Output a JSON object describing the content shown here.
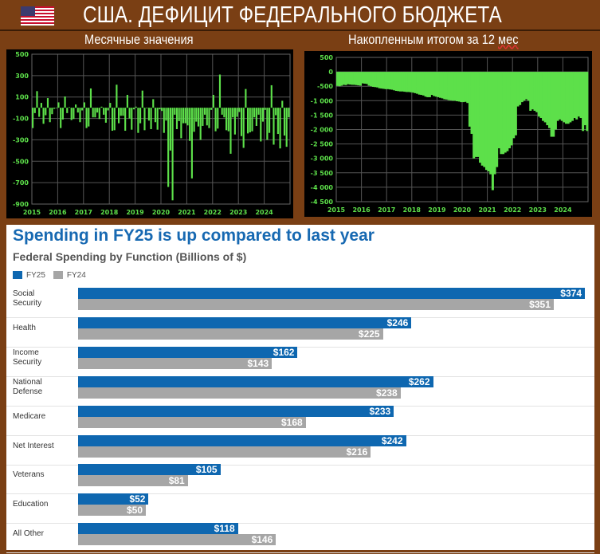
{
  "header": {
    "title": "США. ДЕФИЦИТ ФЕДЕРАЛЬНОГО БЮДЖЕТА",
    "left_caption": "Месячные значения",
    "right_caption_main": "Накопленным итогом за 12 ",
    "right_caption_tail": "мес",
    "flag_icon": "us-flag"
  },
  "colors": {
    "background": "#7a3f14",
    "bar_green": "#5de04a",
    "fy25": "#0e67b0",
    "fy24": "#a6a6a6",
    "title_blue": "#1769b2"
  },
  "chart_data": [
    {
      "type": "bar",
      "title": "",
      "ylim": [
        -900,
        500
      ],
      "yticks": [
        500,
        300,
        100,
        -100,
        -300,
        -500,
        -700,
        -900
      ],
      "xticks": [
        "2015",
        "2016",
        "2017",
        "2018",
        "2019",
        "2020",
        "2021",
        "2022",
        "2023",
        "2024"
      ],
      "grid": true,
      "frequency": "monthly",
      "start": "2015-01",
      "values": [
        -190,
        -50,
        155,
        -85,
        45,
        -150,
        -70,
        90,
        -135,
        -60,
        -10,
        -5,
        50,
        -190,
        -110,
        105,
        -50,
        5,
        -115,
        -105,
        30,
        -45,
        -135,
        -25,
        50,
        -190,
        -175,
        180,
        -90,
        -90,
        -45,
        -105,
        10,
        -65,
        -140,
        -25,
        45,
        -215,
        -210,
        215,
        -145,
        -75,
        -75,
        -215,
        120,
        -100,
        -205,
        -15,
        10,
        -235,
        -145,
        160,
        -210,
        -5,
        -120,
        -200,
        80,
        -135,
        -205,
        -15,
        -30,
        -235,
        -120,
        -740,
        -400,
        -865,
        -65,
        -200,
        -125,
        -285,
        -145,
        -145,
        -165,
        -310,
        -660,
        -225,
        -130,
        -175,
        -300,
        -170,
        -65,
        -165,
        -190,
        -20,
        120,
        -220,
        -195,
        310,
        -65,
        -90,
        -210,
        -220,
        -430,
        -90,
        -250,
        -85,
        -40,
        -265,
        -375,
        175,
        -240,
        -230,
        -220,
        -90,
        -170,
        -65,
        -315,
        -130,
        -20,
        -300,
        -235,
        210,
        -345,
        -70,
        -245,
        -380,
        65,
        -260,
        -365,
        -90
      ]
    },
    {
      "type": "area",
      "title": "",
      "ylim": [
        -4500,
        500
      ],
      "yticks": [
        "500",
        "0",
        "-500",
        "-1 000",
        "-1 500",
        "-2 000",
        "-2 500",
        "-3 000",
        "-3 500",
        "-4 000",
        "-4 500"
      ],
      "xticks": [
        "2015",
        "2016",
        "2017",
        "2018",
        "2019",
        "2020",
        "2021",
        "2022",
        "2023",
        "2024"
      ],
      "grid": true,
      "frequency": "monthly",
      "start": "2015-01",
      "values": [
        -490,
        -500,
        -480,
        -450,
        -460,
        -430,
        -440,
        -450,
        -450,
        -460,
        -470,
        -480,
        -400,
        -410,
        -420,
        -480,
        -500,
        -520,
        -530,
        -540,
        -570,
        -580,
        -590,
        -600,
        -600,
        -610,
        -620,
        -640,
        -660,
        -670,
        -680,
        -680,
        -690,
        -700,
        -700,
        -710,
        -720,
        -740,
        -760,
        -790,
        -800,
        -820,
        -860,
        -880,
        -880,
        -800,
        -840,
        -860,
        -880,
        -900,
        -920,
        -950,
        -960,
        -980,
        -990,
        -1000,
        -1000,
        -1020,
        -1030,
        -1050,
        -1050,
        -1040,
        -1080,
        -1900,
        -2150,
        -3000,
        -2950,
        -2950,
        -3150,
        -3250,
        -3300,
        -3400,
        -3450,
        -3550,
        -4100,
        -3550,
        -3300,
        -2650,
        -2850,
        -2850,
        -2800,
        -2750,
        -2650,
        -2550,
        -2300,
        -2200,
        -1200,
        -1150,
        -1050,
        -1000,
        -950,
        -1000,
        -1350,
        -1300,
        -1350,
        -1400,
        -1550,
        -1600,
        -1700,
        -1750,
        -1850,
        -1950,
        -2250,
        -2250,
        -2000,
        -1700,
        -1650,
        -1700,
        -1750,
        -1800,
        -1800,
        -1750,
        -1700,
        -1600,
        -1650,
        -1550,
        -1600,
        -2050,
        -1850,
        -2050
      ]
    },
    {
      "type": "bar",
      "orientation": "horizontal",
      "title": "Spending in FY25 is up compared to last year",
      "subtitle": "Federal Spending by Function (Billions of $)",
      "legend_placement": "top-left",
      "series": [
        {
          "name": "FY25",
          "values": [
            374,
            246,
            162,
            262,
            233,
            242,
            105,
            52,
            118
          ]
        },
        {
          "name": "FY24",
          "values": [
            351,
            225,
            143,
            238,
            168,
            216,
            81,
            50,
            146
          ]
        }
      ],
      "categories": [
        [
          "Social",
          "Security"
        ],
        [
          "Health"
        ],
        [
          "Income",
          "Security"
        ],
        [
          "National",
          "Defense"
        ],
        [
          "Medicare"
        ],
        [
          "Net Interest"
        ],
        [
          "Veterans"
        ],
        [
          "Education"
        ],
        [
          "All Other"
        ]
      ],
      "labels_fy25": [
        "$374",
        "$246",
        "$162",
        "$262",
        "$233",
        "$242",
        "$105",
        "$52",
        "$118"
      ],
      "labels_fy24": [
        "$351",
        "$225",
        "$143",
        "$238",
        "$168",
        "$216",
        "$81",
        "$50",
        "$146"
      ]
    }
  ]
}
